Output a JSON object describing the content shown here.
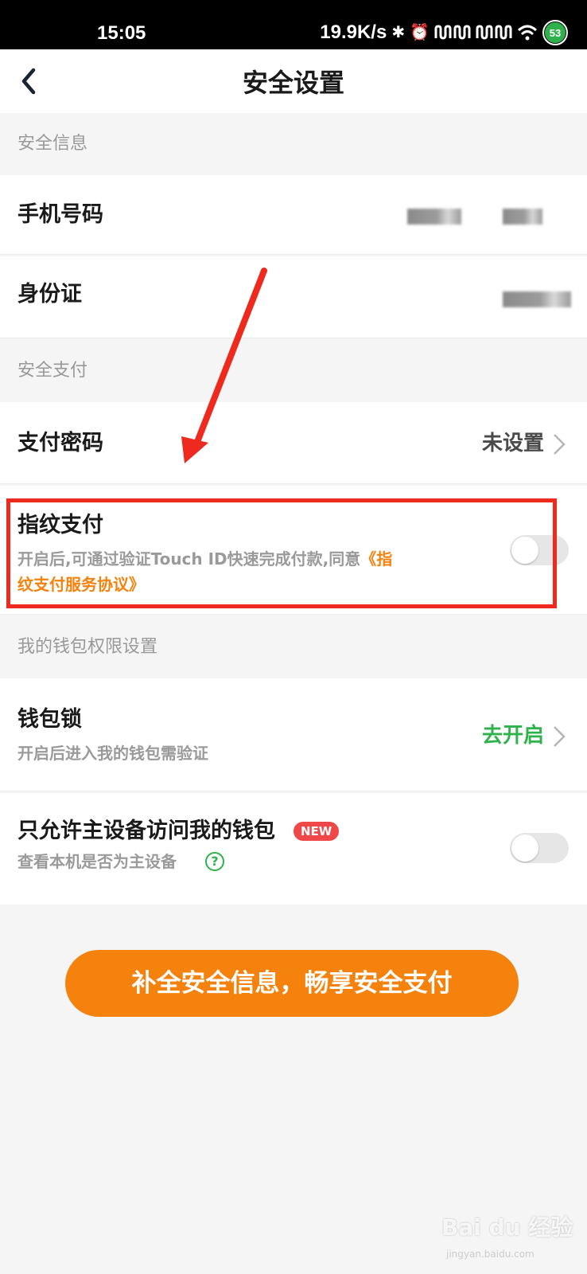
{
  "status_bar": {
    "time": "15:05",
    "speed": "19.9K/s",
    "battery": "53"
  },
  "nav": {
    "title": "安全设置"
  },
  "sections": {
    "security_info": "安全信息",
    "secure_payment": "安全支付",
    "wallet_permissions": "我的钱包权限设置"
  },
  "rows": {
    "phone": {
      "title": "手机号码"
    },
    "id_card": {
      "title": "身份证"
    },
    "pay_password": {
      "title": "支付密码",
      "value": "未设置"
    },
    "fingerprint": {
      "title": "指纹支付",
      "desc": "开启后,可通过验证Touch ID快速完成付款,同意",
      "link_part1": "《指",
      "link_part2": "纹支付服务协议》",
      "enabled": false
    },
    "wallet_lock": {
      "title": "钱包锁",
      "desc": "开启后进入我的钱包需验证",
      "value": "去开启"
    },
    "main_device": {
      "title": "只允许主设备访问我的钱包",
      "badge": "NEW",
      "desc": "查看本机是否为主设备",
      "help": "?",
      "enabled": false
    }
  },
  "cta": {
    "label": "补全安全信息，畅享安全支付"
  },
  "watermark": {
    "brand": "Bai du 经验",
    "site": "jingyan.baidu.com"
  },
  "colors": {
    "accent_orange": "#f5820d",
    "accent_green": "#2fb24c",
    "annotation_red": "#ee2a1e",
    "badge_red": "#f04848"
  }
}
